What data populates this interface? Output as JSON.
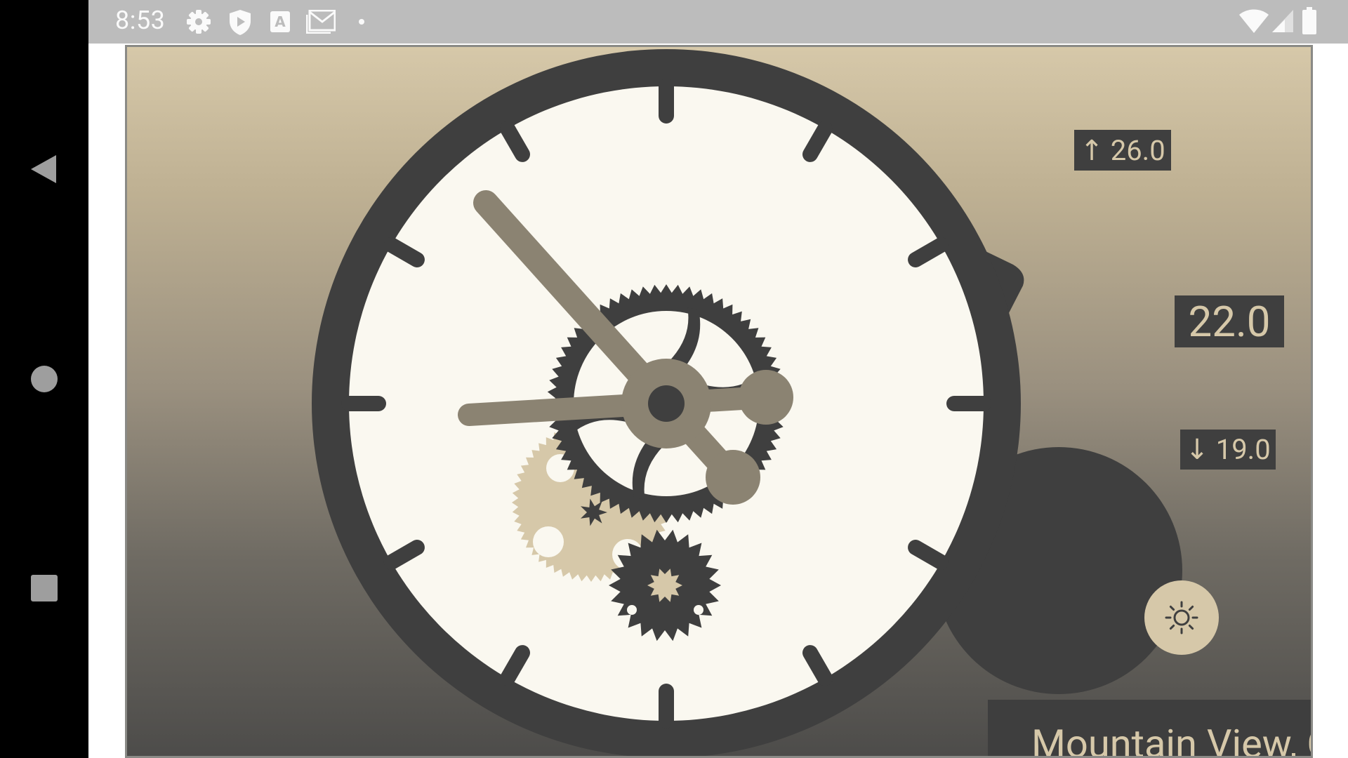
{
  "status_bar": {
    "time": "8:53",
    "left_icons": [
      "settings-icon",
      "shield-icon",
      "a-icon",
      "gmail-icon",
      "dot-icon"
    ],
    "right_icons": [
      "wifi-icon",
      "signal-icon",
      "battery-icon"
    ]
  },
  "nav_bar": {
    "buttons": [
      "back-button",
      "home-button",
      "recents-button"
    ]
  },
  "weather_clock": {
    "temp_high": "↑ 26.0",
    "temp_current": "22.0",
    "temp_low": "↓ 19.0",
    "location": "Mountain View, CA",
    "theme_button_icon": "sun-icon"
  },
  "colors": {
    "dark": "#3f3f3f",
    "beige": "#d6c8a9",
    "hand": "#8b8372",
    "dial": "#faf8f0"
  }
}
